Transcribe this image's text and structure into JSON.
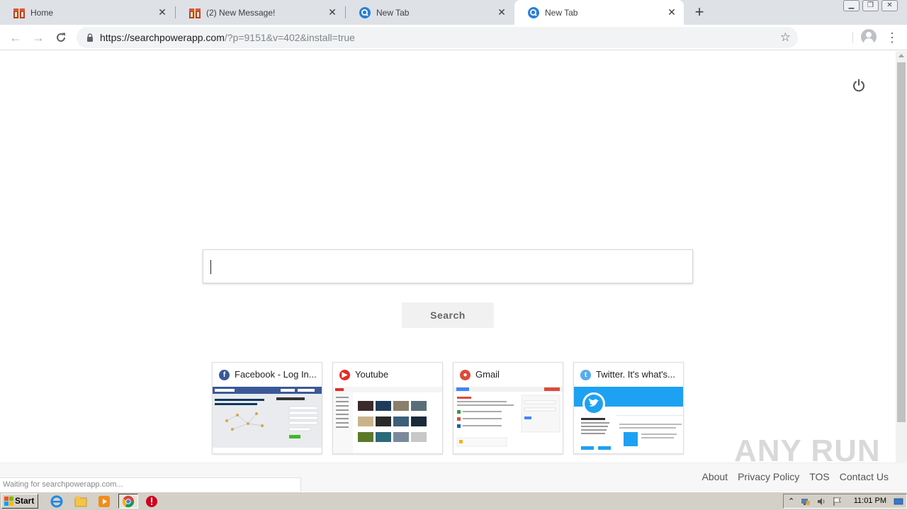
{
  "browser": {
    "tabs": [
      {
        "title": "Home",
        "favicon": "gift-box-icon",
        "active": false
      },
      {
        "title": "(2) New Message!",
        "favicon": "gift-box-icon",
        "active": false
      },
      {
        "title": "New Tab",
        "favicon": "searchpower-q-icon",
        "active": false
      },
      {
        "title": "New Tab",
        "favicon": "searchpower-q-icon",
        "active": true
      }
    ],
    "new_tab_label": "+",
    "url_host": "https://searchpowerapp.com",
    "url_rest": "/?p=9151&v=402&install=true"
  },
  "page": {
    "search_placeholder": "",
    "search_button": "Search",
    "tiles": [
      {
        "label": "Facebook - Log In...",
        "icon": "facebook-icon",
        "color": "#3b5998"
      },
      {
        "label": "Youtube",
        "icon": "youtube-icon",
        "color": "#e52d27"
      },
      {
        "label": "Gmail",
        "icon": "gmail-icon",
        "color": "#dd4b39"
      },
      {
        "label": "Twitter. It's what's...",
        "icon": "twitter-icon",
        "color": "#55acee"
      }
    ],
    "footer_links": [
      "About",
      "Privacy Policy",
      "TOS",
      "Contact Us"
    ],
    "status_text": "Waiting for searchpowerapp.com...",
    "watermark": "ANY RUN"
  },
  "taskbar": {
    "start_label": "Start",
    "clock": "11:01 PM"
  }
}
